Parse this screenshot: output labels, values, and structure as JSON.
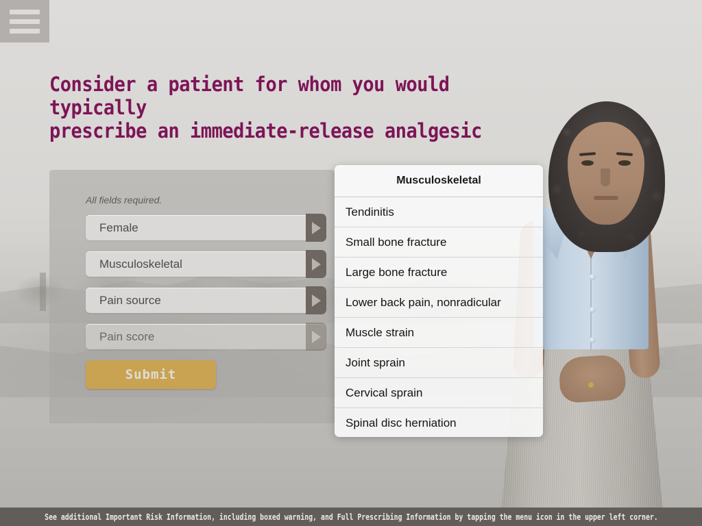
{
  "menu": {
    "icon": "hamburger-menu-icon",
    "label": "Menu"
  },
  "headline": {
    "line1": "Consider a patient for whom you would typically",
    "line2": "prescribe an immediate-release analgesic",
    "color": "#7d1457"
  },
  "form": {
    "required_note": "All fields required.",
    "fields": [
      {
        "name": "gender",
        "value": "Female",
        "disabled": false,
        "arrow_icon": "play-triangle-icon"
      },
      {
        "name": "pain-category",
        "value": "Musculoskeletal",
        "disabled": false,
        "arrow_icon": "play-triangle-icon"
      },
      {
        "name": "pain-source",
        "value": "Pain source",
        "disabled": false,
        "arrow_icon": "play-triangle-icon"
      },
      {
        "name": "pain-score",
        "value": "Pain score",
        "disabled": true,
        "arrow_icon": "play-triangle-icon"
      }
    ],
    "submit_label": "Submit",
    "submit_color": "#c9a351"
  },
  "dropdown": {
    "header": "Musculoskeletal",
    "items": [
      "Tendinitis",
      "Small bone fracture",
      "Large bone fracture",
      "Lower back pain, nonradicular",
      "Muscle strain",
      "Joint sprain",
      "Cervical sprain",
      "Spinal disc herniation"
    ]
  },
  "footer": {
    "text": "See additional Important Risk Information, including boxed warning, and Full Prescribing Information by tapping the menu icon in the upper left corner.",
    "background": "#615d59"
  }
}
